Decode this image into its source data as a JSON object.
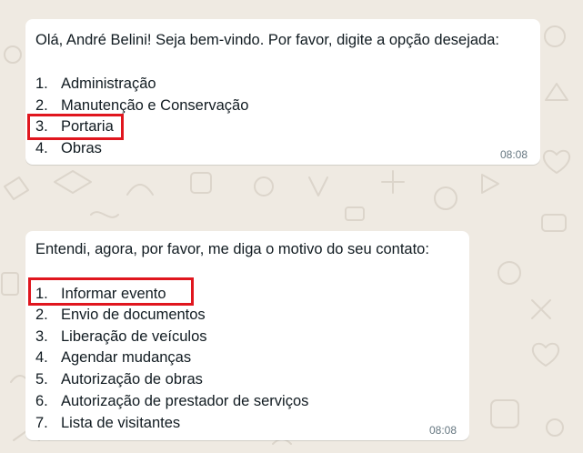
{
  "messages": [
    {
      "text": "Olá, André Belini! Seja bem-vindo. Por favor, digite a opção desejada:",
      "options": [
        {
          "num": "1.",
          "label": "Administração"
        },
        {
          "num": "2.",
          "label": "Manutenção e Conservação"
        },
        {
          "num": "3.",
          "label": "Portaria"
        },
        {
          "num": "4.",
          "label": "Obras"
        }
      ],
      "time": "08:08",
      "highlighted_option": "3"
    },
    {
      "text": "Entendi, agora, por favor, me diga o motivo do seu contato:",
      "options": [
        {
          "num": "1.",
          "label": "Informar evento"
        },
        {
          "num": "2.",
          "label": "Envio de documentos"
        },
        {
          "num": "3.",
          "label": "Liberação de veículos"
        },
        {
          "num": "4.",
          "label": "Agendar mudanças"
        },
        {
          "num": "5.",
          "label": "Autorização de obras"
        },
        {
          "num": "6.",
          "label": "Autorização de prestador de serviços"
        },
        {
          "num": "7.",
          "label": "Lista de visitantes"
        }
      ],
      "time": "08:08",
      "highlighted_option": "1"
    }
  ],
  "colors": {
    "background": "#efeae2",
    "bubble": "#ffffff",
    "text": "#111b21",
    "time": "#667781",
    "highlight": "#e0161e"
  }
}
